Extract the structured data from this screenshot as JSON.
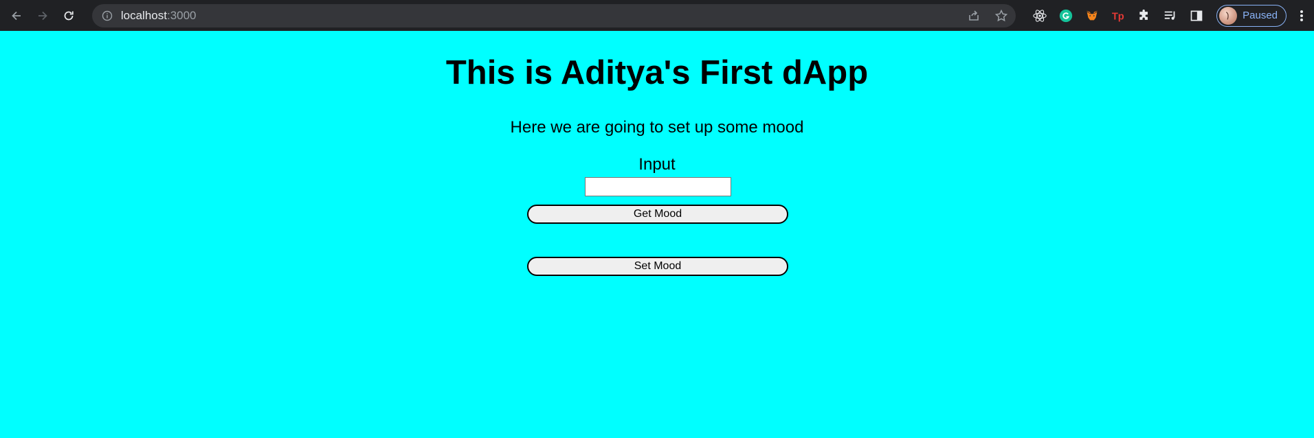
{
  "browser": {
    "url_host": "localhost",
    "url_port": ":3000",
    "profile_status": "Paused",
    "colors": {
      "chrome_bg": "#202124",
      "omnibox_bg": "#35363a",
      "profile_accent": "#8ab4f8"
    },
    "toolbar_icons": [
      "back-arrow-icon",
      "forward-arrow-icon",
      "reload-icon",
      "info-icon",
      "share-icon",
      "bookmark-star-icon"
    ],
    "extensions": [
      "react-devtools-icon",
      "grammarly-icon",
      "metamask-icon",
      "tp-extension-icon",
      "puzzle-extensions-icon",
      "media-playlist-icon",
      "side-panel-icon"
    ]
  },
  "page": {
    "background": "#00ffff",
    "title": "This is Aditya's First dApp",
    "subtitle": "Here we are going to set up some mood",
    "input_label": "Input",
    "input_value": "",
    "get_button": "Get Mood",
    "set_button": "Set Mood"
  }
}
